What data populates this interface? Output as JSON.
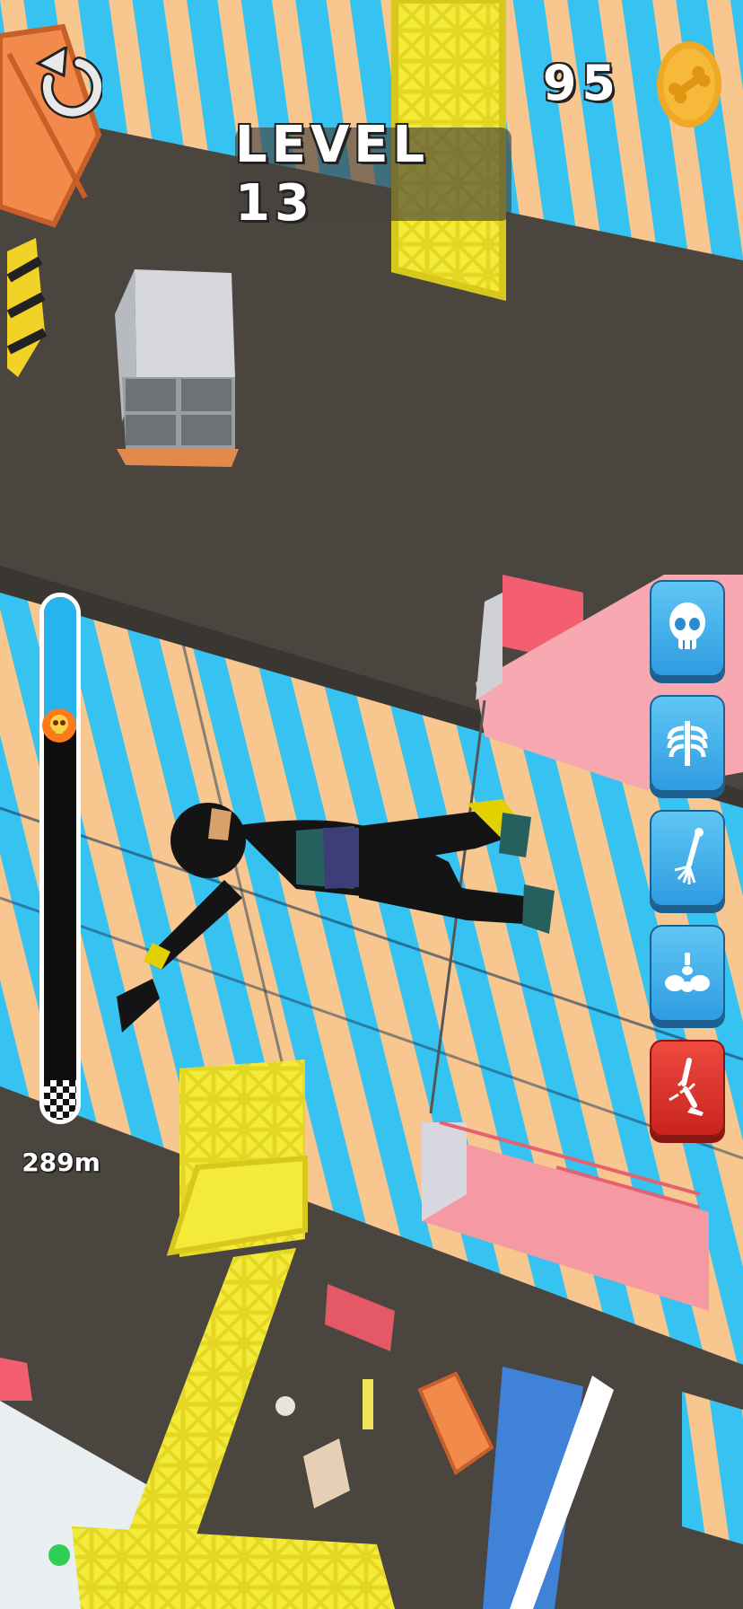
{
  "hud": {
    "level_label": "LEVEL 13",
    "coins": "95",
    "distance": "289m",
    "progress_fraction": 0.25,
    "restart_icon": "restart-arrow-icon",
    "coin_icon": "bone-coin-icon",
    "marker_icon": "skull-marker-icon"
  },
  "powerups": [
    {
      "icon": "skull-icon",
      "color": "#3aa6e8",
      "selected": false
    },
    {
      "icon": "ribcage-icon",
      "color": "#3aa6e8",
      "selected": false
    },
    {
      "icon": "arm-bone-icon",
      "color": "#3aa6e8",
      "selected": false
    },
    {
      "icon": "pelvis-icon",
      "color": "#3aa6e8",
      "selected": false
    },
    {
      "icon": "leg-break-icon",
      "color": "#d9302a",
      "selected": true
    }
  ],
  "colors": {
    "stripe_blue": "#36c3f2",
    "stripe_peach": "#f8c68f",
    "floor": "#4a453f",
    "crane_yellow": "#f4ea3a",
    "scaffold_pink": "#f59aa3",
    "ninja": "#141414",
    "ninja_accent": "#26605e"
  }
}
